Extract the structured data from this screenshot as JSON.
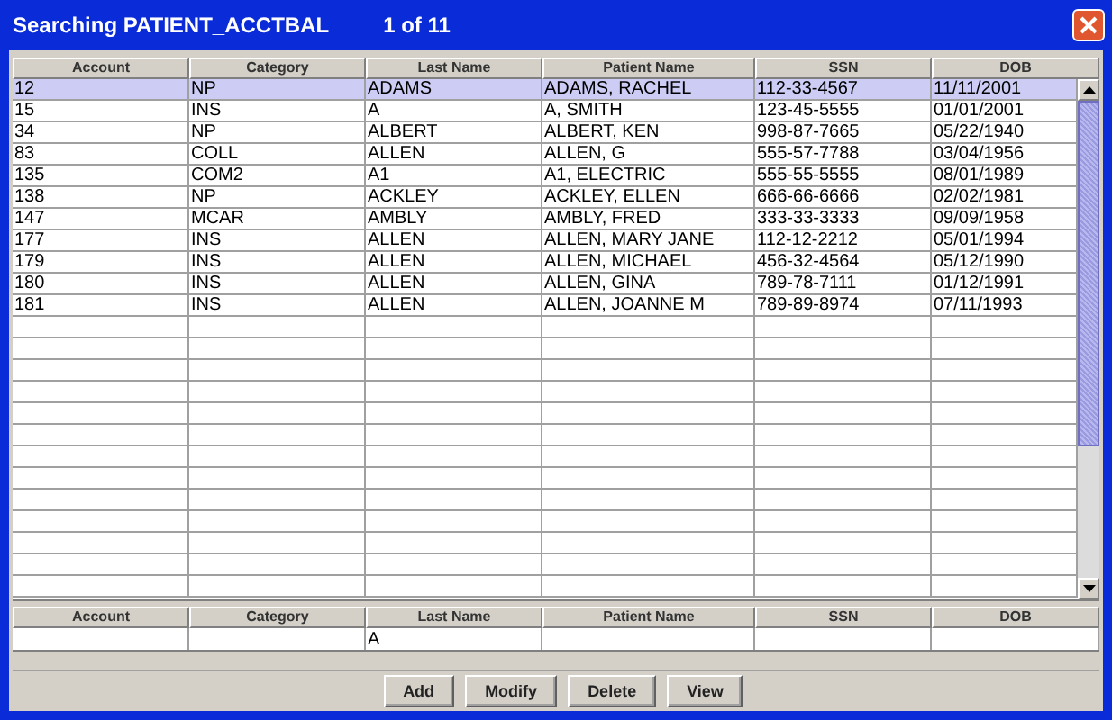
{
  "window": {
    "title": "Searching PATIENT_ACCTBAL",
    "record_count": "1 of 11"
  },
  "table": {
    "columns": [
      "Account",
      "Category",
      "Last Name",
      "Patient Name",
      "SSN",
      "DOB"
    ],
    "rows": [
      {
        "cells": [
          "12",
          "NP",
          "ADAMS",
          "ADAMS, RACHEL",
          "112-33-4567",
          "11/11/2001"
        ],
        "selected": true
      },
      {
        "cells": [
          "15",
          "INS",
          "A",
          "A, SMITH",
          "123-45-5555",
          "01/01/2001"
        ],
        "selected": false
      },
      {
        "cells": [
          "34",
          "NP",
          "ALBERT",
          "ALBERT, KEN",
          "998-87-7665",
          "05/22/1940"
        ],
        "selected": false
      },
      {
        "cells": [
          "83",
          "COLL",
          "ALLEN",
          "ALLEN, G",
          "555-57-7788",
          "03/04/1956"
        ],
        "selected": false
      },
      {
        "cells": [
          "135",
          "COM2",
          "A1",
          "A1, ELECTRIC",
          "555-55-5555",
          "08/01/1989"
        ],
        "selected": false
      },
      {
        "cells": [
          "138",
          "NP",
          "ACKLEY",
          "ACKLEY, ELLEN",
          "666-66-6666",
          "02/02/1981"
        ],
        "selected": false
      },
      {
        "cells": [
          "147",
          "MCAR",
          "AMBLY",
          "AMBLY, FRED",
          "333-33-3333",
          "09/09/1958"
        ],
        "selected": false
      },
      {
        "cells": [
          "177",
          "INS",
          "ALLEN",
          "ALLEN, MARY JANE",
          "112-12-2212",
          "05/01/1994"
        ],
        "selected": false
      },
      {
        "cells": [
          "179",
          "INS",
          "ALLEN",
          "ALLEN, MICHAEL",
          "456-32-4564",
          "05/12/1990"
        ],
        "selected": false
      },
      {
        "cells": [
          "180",
          "INS",
          "ALLEN",
          "ALLEN, GINA",
          "789-78-7111",
          "01/12/1991"
        ],
        "selected": false
      },
      {
        "cells": [
          "181",
          "INS",
          "ALLEN",
          "ALLEN, JOANNE M",
          "789-89-8974",
          "07/11/1993"
        ],
        "selected": false
      }
    ]
  },
  "filter": {
    "fields": [
      {
        "column": "Account"
      },
      {
        "column": "Category"
      },
      {
        "column": "Last Name",
        "value": "A"
      },
      {
        "column": "Patient Name"
      },
      {
        "column": "SSN"
      },
      {
        "column": "DOB"
      }
    ]
  },
  "buttons": [
    "Add",
    "Modify",
    "Delete",
    "View"
  ]
}
